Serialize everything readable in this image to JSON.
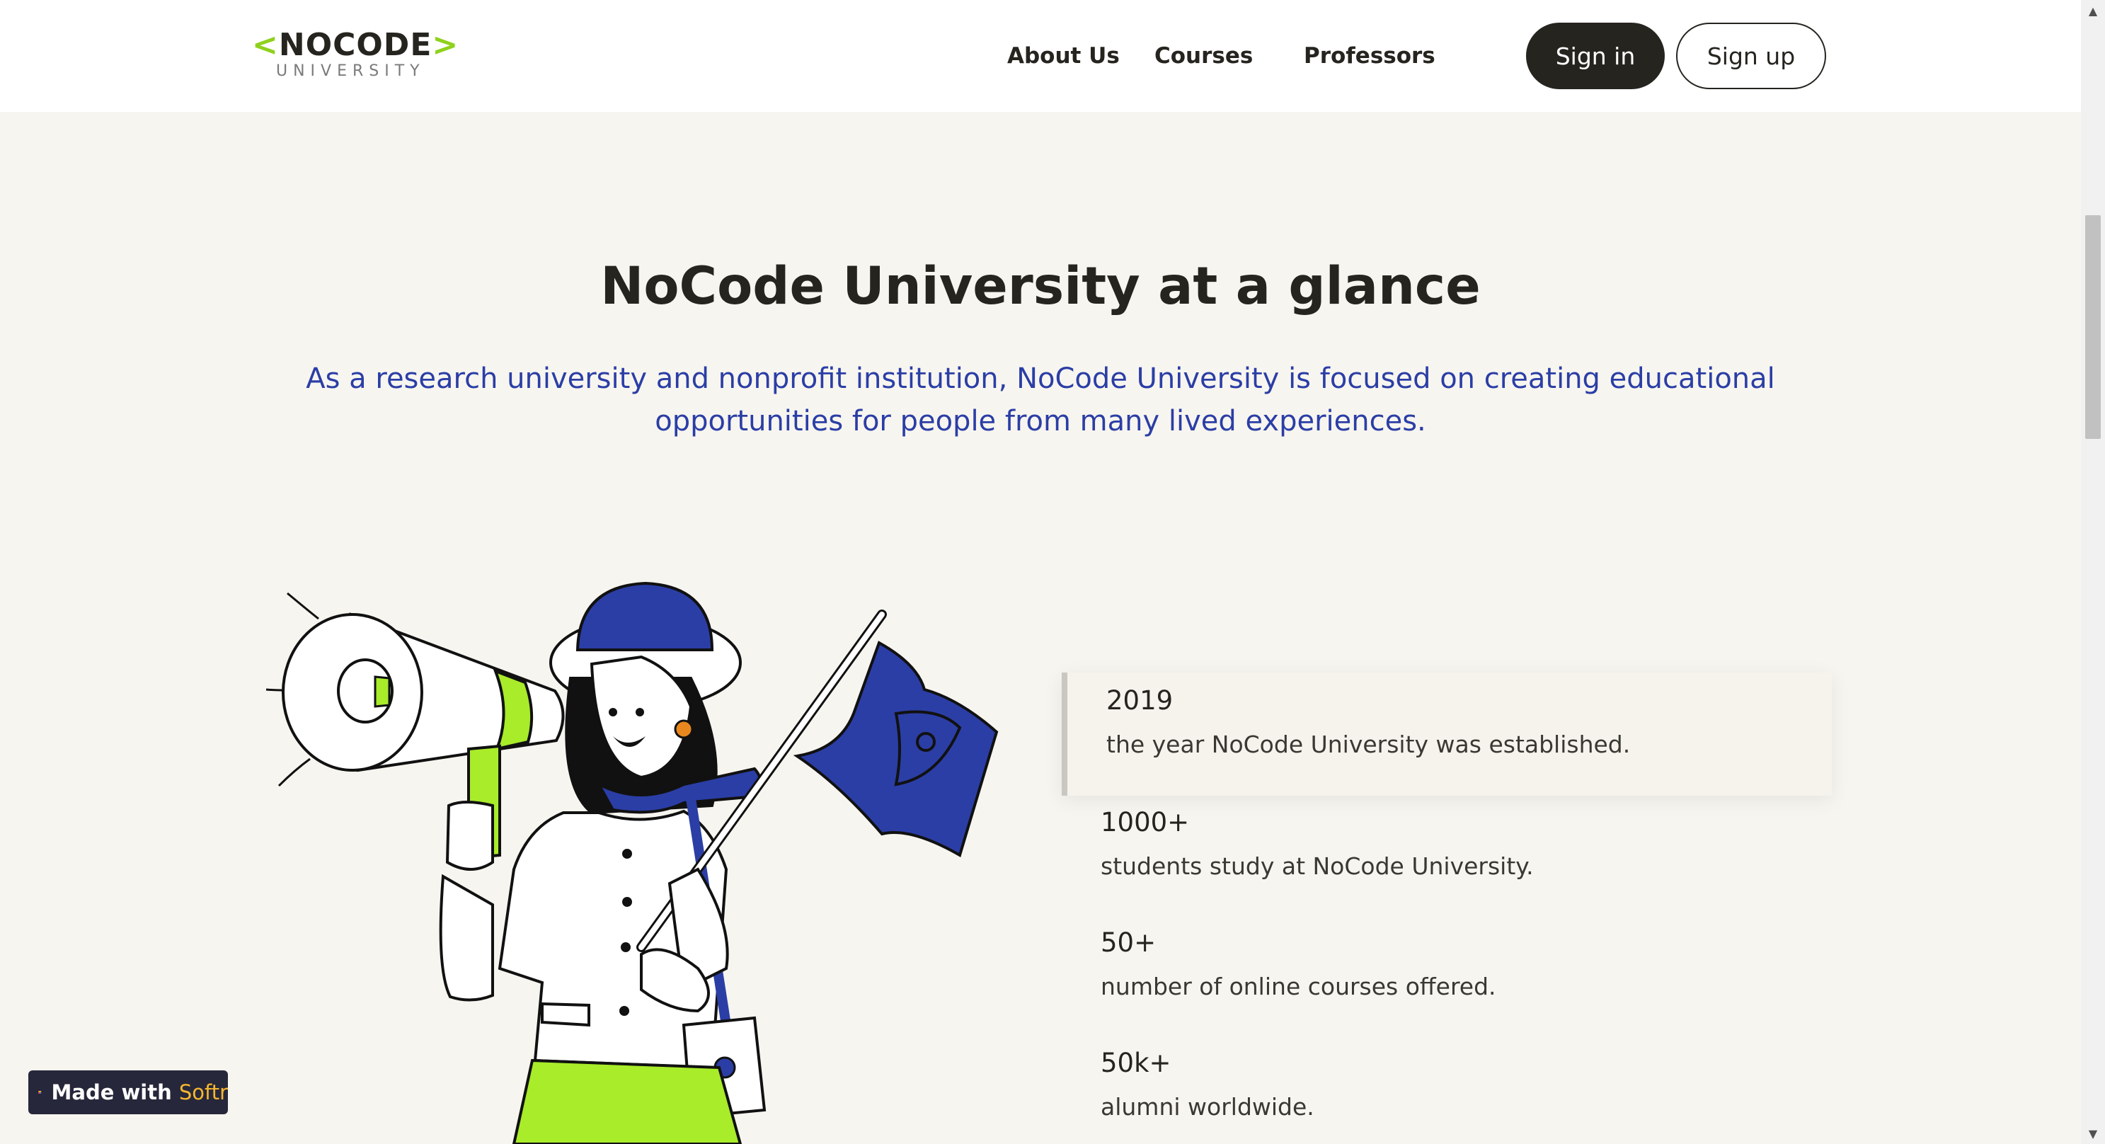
{
  "header": {
    "logo": {
      "left_bracket": "<",
      "word": "NOCODE",
      "right_bracket": ">",
      "sub": "UNIVERSITY"
    },
    "nav": [
      {
        "label": "About Us"
      },
      {
        "label": "Courses"
      },
      {
        "label": "Professors"
      }
    ],
    "signin_label": "Sign in",
    "signup_label": "Sign up"
  },
  "hero": {
    "title": "NoCode University at a glance",
    "subtitle": "As a research university and nonprofit institution, NoCode University is focused on creating educational opportunities for people from many lived experiences."
  },
  "stats": [
    {
      "value": "2019",
      "desc": "the year NoCode University was established."
    },
    {
      "value": "1000+",
      "desc": "students study at NoCode University."
    },
    {
      "value": "50+",
      "desc": "number of online courses offered."
    },
    {
      "value": "50k+",
      "desc": "alumni worldwide."
    }
  ],
  "badge": {
    "prefix": "Made with",
    "brand": "Softr"
  },
  "colors": {
    "accent_green": "#a8ec2a",
    "accent_blue": "#2b3ea6",
    "background": "#f7f5ef",
    "dark": "#26241f"
  }
}
